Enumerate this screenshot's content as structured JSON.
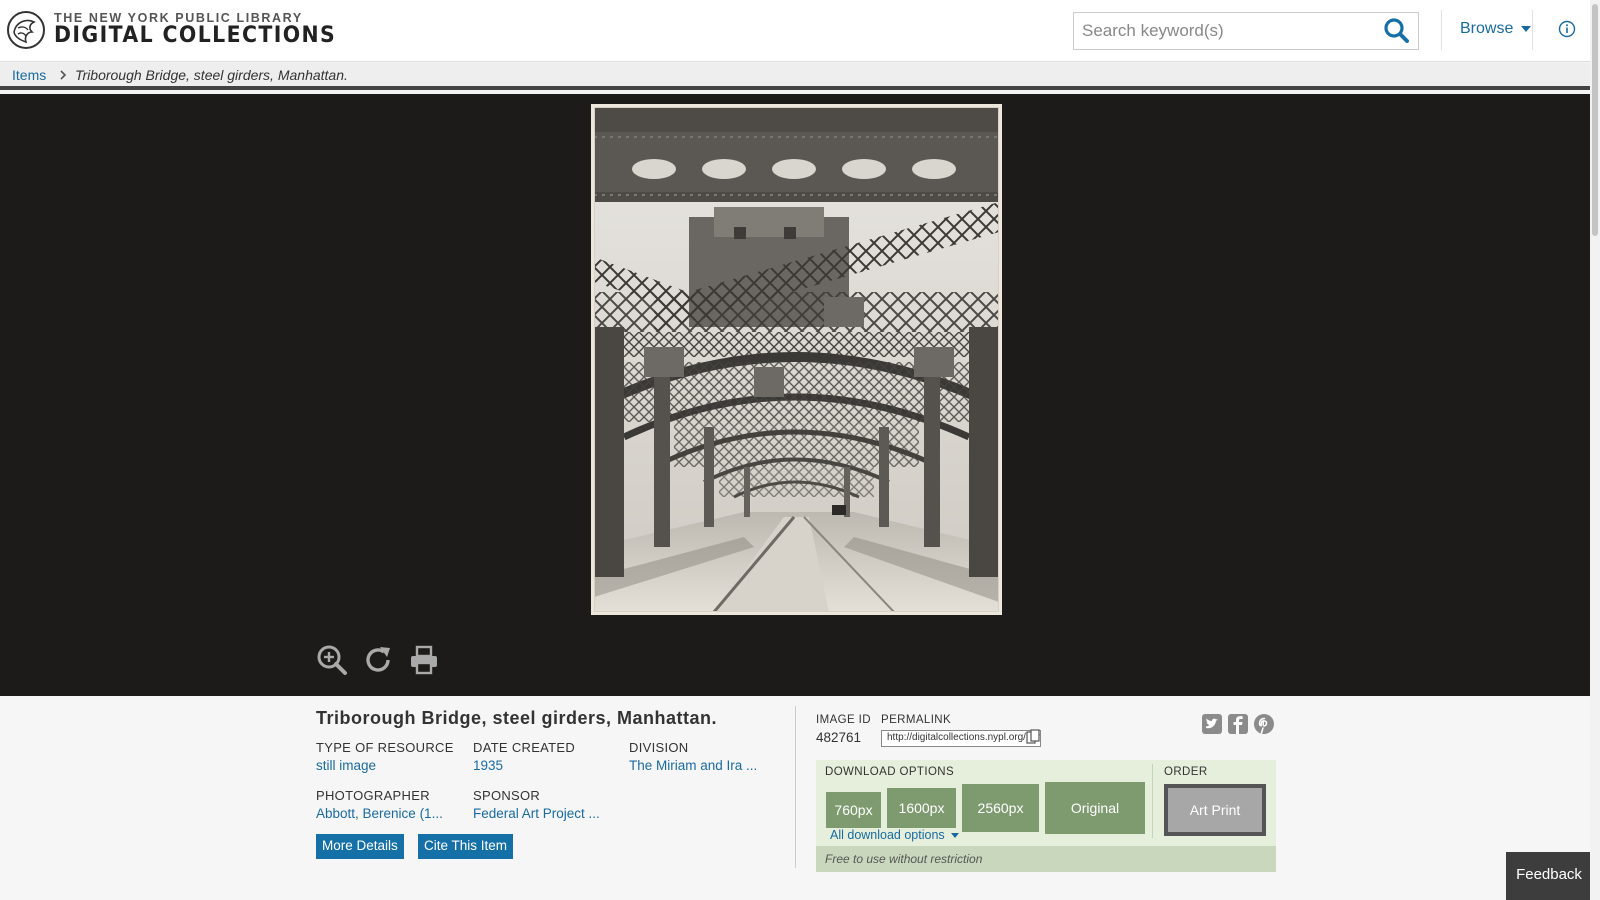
{
  "header": {
    "brand_top": "THE NEW YORK PUBLIC LIBRARY",
    "brand_main": "DIGITAL COLLECTIONS",
    "search_placeholder": "Search keyword(s)",
    "browse_label": "Browse"
  },
  "breadcrumb": {
    "items_label": "Items",
    "current": "Triborough Bridge, steel girders, Manhattan."
  },
  "viewer": {
    "tools": [
      "zoom-in-icon",
      "rotate-icon",
      "print-icon"
    ]
  },
  "item": {
    "title": "Triborough Bridge, steel girders, Manhattan.",
    "fields": {
      "type_of_resource": {
        "label": "TYPE OF RESOURCE",
        "value": "still image"
      },
      "date_created": {
        "label": "DATE CREATED",
        "value": "1935"
      },
      "division": {
        "label": "DIVISION",
        "value": "The Miriam and Ira ..."
      },
      "photographer": {
        "label": "PHOTOGRAPHER",
        "value": "Abbott, Berenice (1..."
      },
      "sponsor": {
        "label": "SPONSOR",
        "value": "Federal Art Project ..."
      }
    },
    "more_details_label": "More Details",
    "cite_label": "Cite This Item"
  },
  "image_info": {
    "image_id_label": "IMAGE ID",
    "image_id": "482761",
    "permalink_label": "PERMALINK",
    "permalink": "http://digitalcollections.nypl.org/items/"
  },
  "social": [
    "twitter-icon",
    "facebook-icon",
    "pinterest-icon"
  ],
  "download": {
    "label": "DOWNLOAD OPTIONS",
    "options": [
      "760px",
      "1600px",
      "2560px",
      "Original"
    ],
    "all_label": "All download options",
    "rights": "Free to use without restriction"
  },
  "order": {
    "label": "ORDER",
    "art_print_label": "Art Print"
  },
  "feedback_label": "Feedback",
  "colors": {
    "link": "#1a6aa0",
    "button_blue": "#1670a8",
    "download_green": "#7e9b70",
    "viewer_bg": "#1d1b1a"
  }
}
